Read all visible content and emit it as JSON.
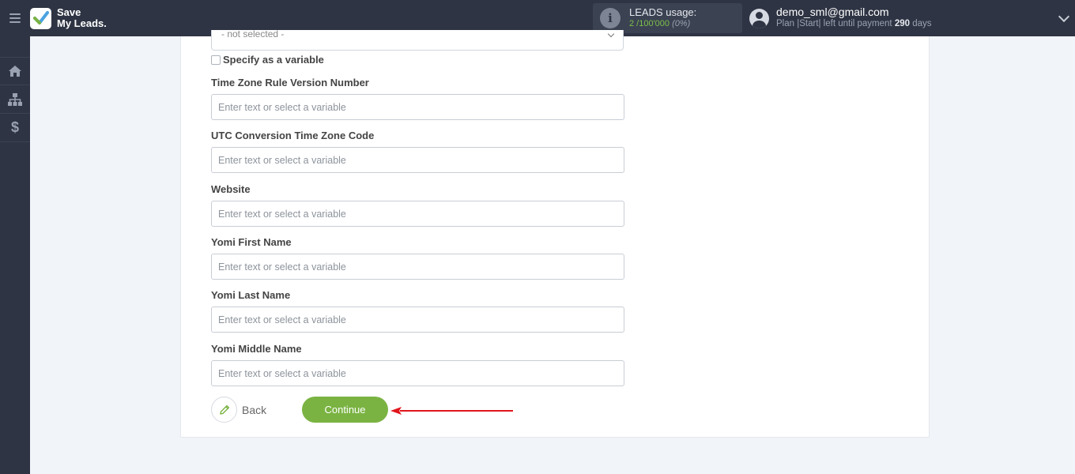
{
  "app": {
    "logo_line1": "Save",
    "logo_line2": "My Leads."
  },
  "header": {
    "usage_label": "LEADS usage:",
    "usage_used": "2 /100'000",
    "usage_percent": "(0%)",
    "user_email": "demo_sml@gmail.com",
    "plan_prefix": "Plan |Start| left until payment",
    "plan_days": "290",
    "plan_suffix": "days"
  },
  "sidebar": {
    "items": [
      {
        "icon": "home-icon"
      },
      {
        "icon": "sitemap-icon"
      },
      {
        "icon": "dollar-icon",
        "glyph": "$"
      }
    ]
  },
  "form": {
    "select_value": "- not selected -",
    "specify_variable_label": "Specify as a variable",
    "fields": [
      {
        "label": "Time Zone Rule Version Number",
        "placeholder": "Enter text or select a variable"
      },
      {
        "label": "UTC Conversion Time Zone Code",
        "placeholder": "Enter text or select a variable"
      },
      {
        "label": "Website",
        "placeholder": "Enter text or select a variable"
      },
      {
        "label": "Yomi First Name",
        "placeholder": "Enter text or select a variable"
      },
      {
        "label": "Yomi Last Name",
        "placeholder": "Enter text or select a variable"
      },
      {
        "label": "Yomi Middle Name",
        "placeholder": "Enter text or select a variable"
      }
    ],
    "back_label": "Back",
    "continue_label": "Continue"
  },
  "colors": {
    "header_bg": "#2e3443",
    "accent_green": "#7ab342",
    "annotation_arrow": "#e0161c"
  }
}
